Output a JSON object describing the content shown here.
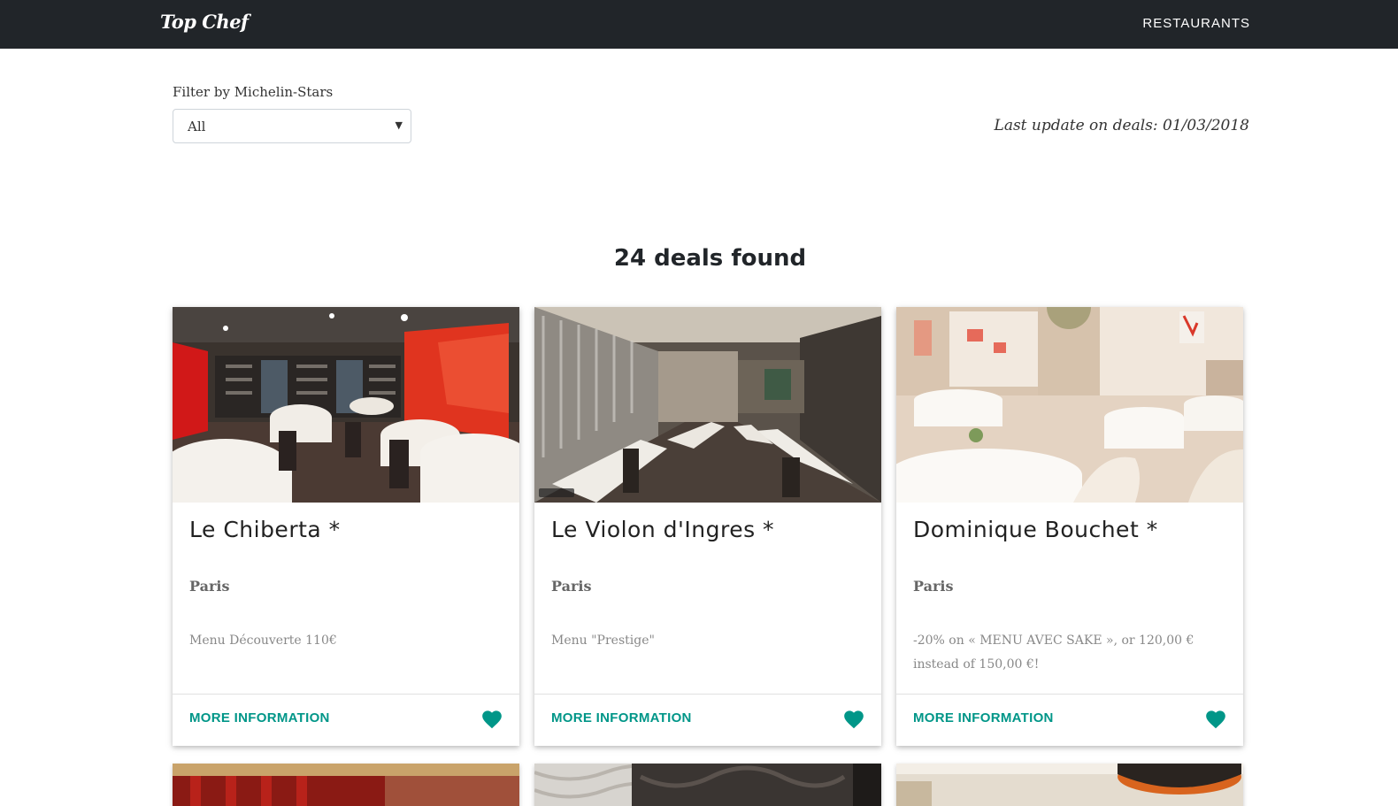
{
  "navbar": {
    "brand": "Top Chef",
    "link": "RESTAURANTS"
  },
  "filter": {
    "label": "Filter by Michelin-Stars",
    "selected": "All"
  },
  "last_update": "Last update on deals: 01/03/2018",
  "deals_heading": "24 deals found",
  "cards": [
    {
      "title": "Le Chiberta *",
      "city": "Paris",
      "deal": "Menu Découverte 110€",
      "link": "MORE INFORMATION"
    },
    {
      "title": "Le Violon d'Ingres *",
      "city": "Paris",
      "deal": "Menu \"Prestige\"",
      "link": "MORE INFORMATION"
    },
    {
      "title": "Dominique Bouchet *",
      "city": "Paris",
      "deal": "-20% on « MENU AVEC SAKE », or 120,00 € instead of 150,00 €!",
      "link": "MORE INFORMATION"
    }
  ],
  "colors": {
    "navbar_bg": "#212529",
    "accent": "#009688"
  },
  "icons": {
    "favorite": "heart-icon",
    "select": "caret-down-icon"
  }
}
